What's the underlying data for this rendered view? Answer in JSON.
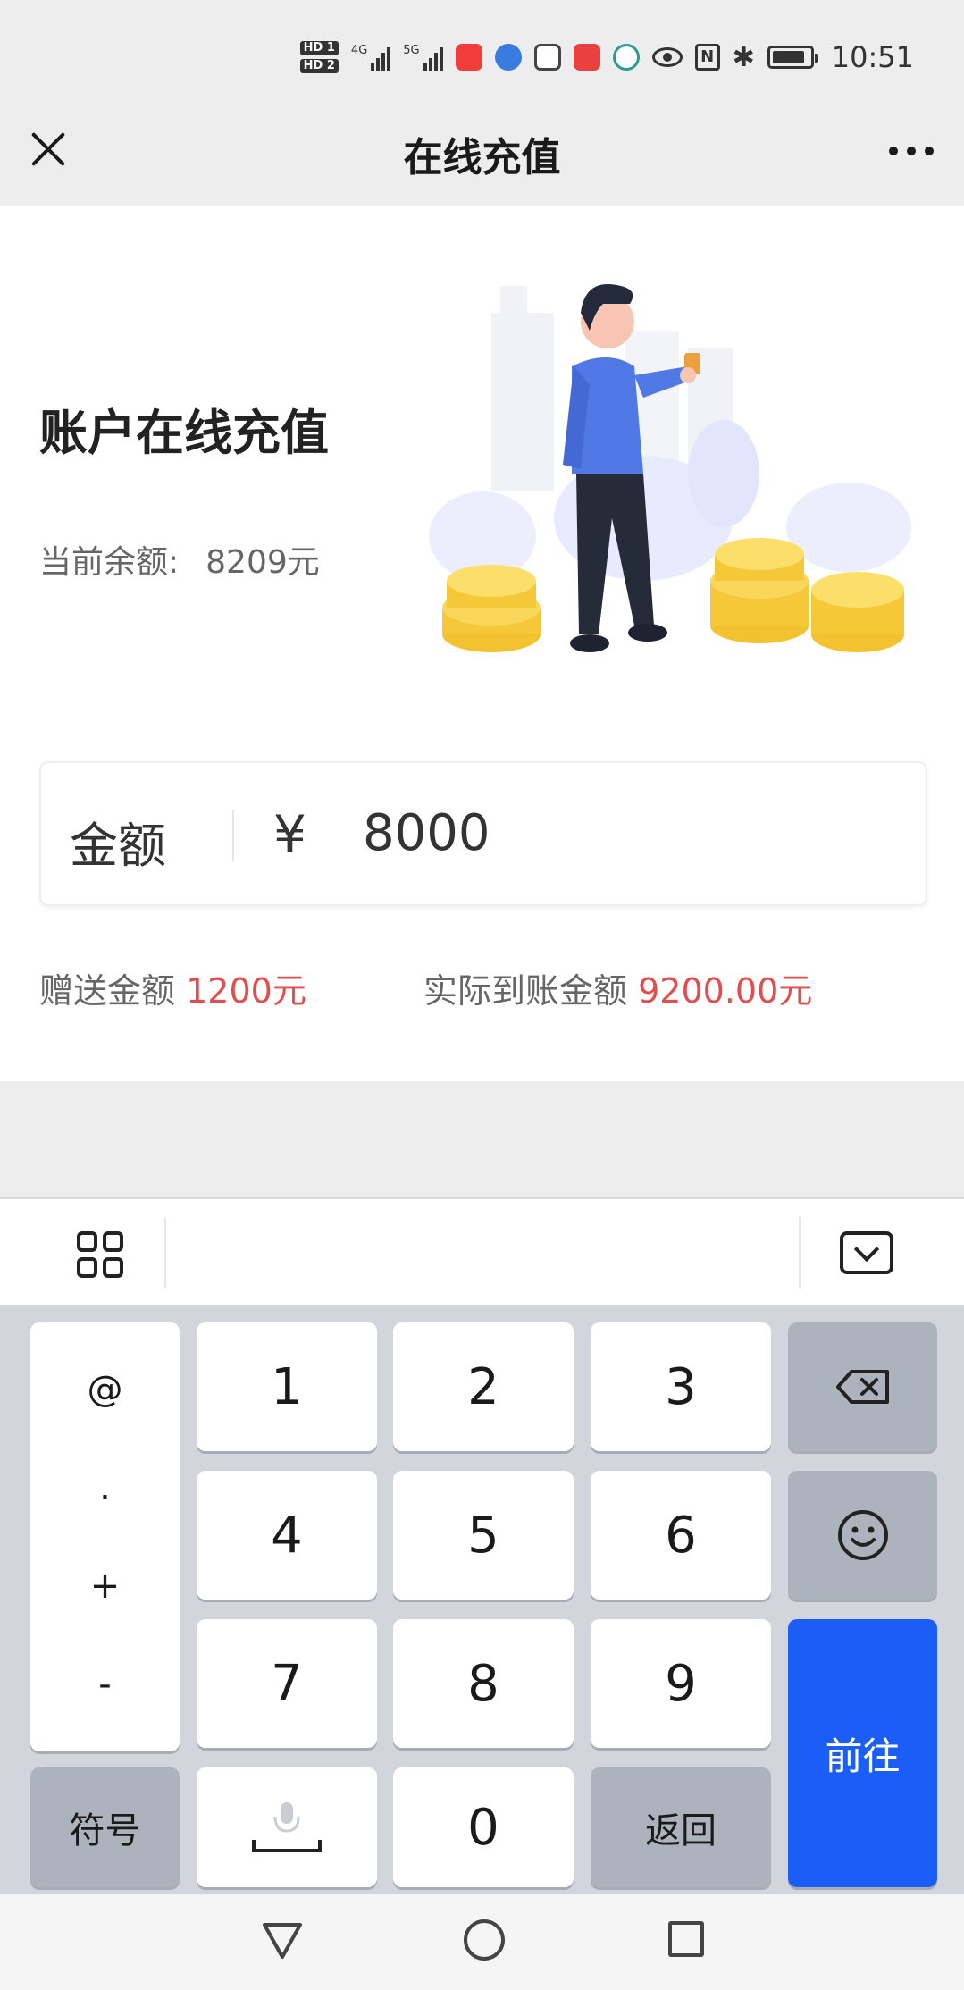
{
  "status_bar": {
    "hd1": "HD 1",
    "hd2": "HD 2",
    "net1": "4G",
    "net2": "5G",
    "time": "10:51",
    "colors": {
      "app1": "#f23b3b",
      "app2": "#3a7be0",
      "app3": "#e94040"
    }
  },
  "titlebar": {
    "title": "在线充值",
    "close_icon": "close-icon",
    "more_icon": "more-icon"
  },
  "page": {
    "heading": "账户在线充值",
    "balance_label": "当前余额:",
    "balance_value": "8209元"
  },
  "amount": {
    "label": "金额",
    "currency": "¥",
    "value": "8000"
  },
  "summary": {
    "bonus_label": "赠送金额",
    "bonus_value": "1200元",
    "actual_label": "实际到账金额",
    "actual_value": "9200.00元",
    "highlight_color": "#e34d4d"
  },
  "keyboard": {
    "symbols": [
      "@",
      ".",
      "+",
      "-"
    ],
    "digits": [
      "1",
      "2",
      "3",
      "4",
      "5",
      "6",
      "7",
      "8",
      "9"
    ],
    "zero": "0",
    "symbol_key": "符号",
    "return_key": "返回",
    "go_key": "前往",
    "go_color": "#1a5ef7"
  }
}
